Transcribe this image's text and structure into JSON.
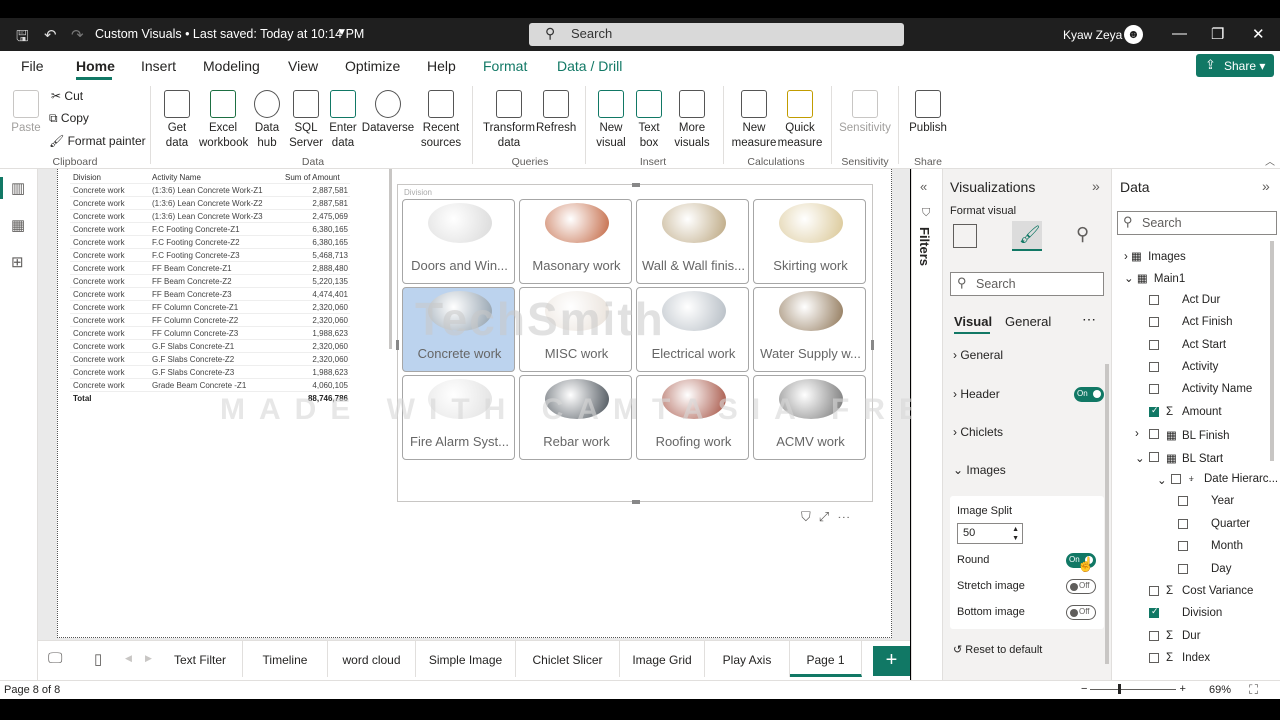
{
  "titlebar": {
    "doc_title": "Custom Visuals • Last saved: Today at 10:14 PM",
    "search_placeholder": "Search",
    "user_name": "Kyaw Zeya"
  },
  "menu": {
    "items": [
      "File",
      "Home",
      "Insert",
      "Modeling",
      "View",
      "Optimize",
      "Help",
      "Format",
      "Data / Drill"
    ],
    "share": "Share"
  },
  "ribbon": {
    "clipboard": {
      "paste": "Paste",
      "cut": "Cut",
      "copy": "Copy",
      "format_painter": "Format painter",
      "group": "Clipboard"
    },
    "data": {
      "get_data": "Get data",
      "excel": "Excel workbook",
      "hub": "Data hub",
      "sql": "SQL Server",
      "enter": "Enter data",
      "dataverse": "Dataverse",
      "recent": "Recent sources",
      "group": "Data"
    },
    "queries": {
      "transform": "Transform data",
      "refresh": "Refresh",
      "group": "Queries"
    },
    "insert": {
      "new_visual": "New visual",
      "text_box": "Text box",
      "more_visuals": "More visuals",
      "group": "Insert"
    },
    "calculations": {
      "new_measure": "New measure",
      "quick_measure": "Quick measure",
      "group": "Calculations"
    },
    "sensitivity": {
      "label": "Sensitivity",
      "group": "Sensitivity"
    },
    "share": {
      "publish": "Publish",
      "group": "Share"
    }
  },
  "table": {
    "headers": [
      "Division",
      "Activity Name",
      "Sum of Amount"
    ],
    "rows": [
      [
        "Concrete work",
        "(1:3:6) Lean Concrete Work-Z1",
        "2,887,581"
      ],
      [
        "Concrete work",
        "(1:3:6) Lean Concrete Work-Z2",
        "2,887,581"
      ],
      [
        "Concrete work",
        "(1:3:6) Lean Concrete Work-Z3",
        "2,475,069"
      ],
      [
        "Concrete work",
        "F.C Footing Concrete-Z1",
        "6,380,165"
      ],
      [
        "Concrete work",
        "F.C Footing Concrete-Z2",
        "6,380,165"
      ],
      [
        "Concrete work",
        "F.C Footing Concrete-Z3",
        "5,468,713"
      ],
      [
        "Concrete work",
        "FF Beam Concrete-Z1",
        "2,888,480"
      ],
      [
        "Concrete work",
        "FF Beam Concrete-Z2",
        "5,220,135"
      ],
      [
        "Concrete work",
        "FF Beam Concrete-Z3",
        "4,474,401"
      ],
      [
        "Concrete work",
        "FF Column Concrete-Z1",
        "2,320,060"
      ],
      [
        "Concrete work",
        "FF Column Concrete-Z2",
        "2,320,060"
      ],
      [
        "Concrete work",
        "FF Column Concrete-Z3",
        "1,988,623"
      ],
      [
        "Concrete work",
        "G.F Slabs Concrete-Z1",
        "2,320,060"
      ],
      [
        "Concrete work",
        "G.F Slabs Concrete-Z2",
        "2,320,060"
      ],
      [
        "Concrete work",
        "G.F Slabs Concrete-Z3",
        "1,988,623"
      ],
      [
        "Concrete work",
        "Grade Beam Concrete -Z1",
        "4,060,105"
      ]
    ],
    "total_label": "Total",
    "total_value": "88,746,786"
  },
  "grid": {
    "title": "Division",
    "tiles": [
      {
        "label": "Doors and Win...",
        "color": "#d8d8d8"
      },
      {
        "label": "Masonary work",
        "color": "#c0603a"
      },
      {
        "label": "Wall & Wall finis...",
        "color": "#b8a27a"
      },
      {
        "label": "Skirting work",
        "color": "#d8c490"
      },
      {
        "label": "Concrete work",
        "color": "#8a9aa8"
      },
      {
        "label": "MISC work",
        "color": "#e8e0d8"
      },
      {
        "label": "Electrical work",
        "color": "#b0b8c0"
      },
      {
        "label": "Water Supply w...",
        "color": "#8a7050"
      },
      {
        "label": "Fire Alarm Syst...",
        "color": "#e0e0e0"
      },
      {
        "label": "Rebar work",
        "color": "#404850"
      },
      {
        "label": "Roofing work",
        "color": "#a04838"
      },
      {
        "label": "ACMV work",
        "color": "#707070"
      }
    ]
  },
  "watermark": {
    "brand": "TechSmith",
    "trial": "MADE WITH CAMTASIA FREE TRIAL"
  },
  "filters": {
    "label": "Filters"
  },
  "visualizations": {
    "title": "Visualizations",
    "subtitle": "Format visual",
    "search": "Search",
    "tabs": [
      "Visual",
      "General"
    ],
    "sections": {
      "general": "General",
      "header": "Header",
      "chiclets": "Chiclets",
      "images": "Images"
    },
    "header_toggle": "On",
    "image_split_label": "Image Split",
    "image_split_value": "50",
    "round_label": "Round",
    "round_toggle": "On",
    "stretch_label": "Stretch image",
    "stretch_toggle": "Off",
    "bottom_label": "Bottom image",
    "bottom_toggle": "Off",
    "reset": "Reset to default"
  },
  "data_pane": {
    "title": "Data",
    "search": "Search",
    "fields": [
      {
        "label": "Images",
        "level": 0,
        "type": "table",
        "check": null
      },
      {
        "label": "Main1",
        "level": 0,
        "type": "table",
        "check": null
      },
      {
        "label": "Act Dur",
        "level": 1,
        "type": "field",
        "check": false
      },
      {
        "label": "Act Finish",
        "level": 1,
        "type": "field",
        "check": false
      },
      {
        "label": "Act Start",
        "level": 1,
        "type": "field",
        "check": false
      },
      {
        "label": "Activity",
        "level": 1,
        "type": "field",
        "check": false
      },
      {
        "label": "Activity Name",
        "level": 1,
        "type": "field",
        "check": false
      },
      {
        "label": "Amount",
        "level": 1,
        "type": "sigma",
        "check": true
      },
      {
        "label": "BL Finish",
        "level": 1,
        "type": "date",
        "check": false
      },
      {
        "label": "BL Start",
        "level": 1,
        "type": "date",
        "check": false
      },
      {
        "label": "Date Hierarc...",
        "level": 2,
        "type": "hier",
        "check": false
      },
      {
        "label": "Year",
        "level": 3,
        "type": "field",
        "check": false
      },
      {
        "label": "Quarter",
        "level": 3,
        "type": "field",
        "check": false
      },
      {
        "label": "Month",
        "level": 3,
        "type": "field",
        "check": false
      },
      {
        "label": "Day",
        "level": 3,
        "type": "field",
        "check": false
      },
      {
        "label": "Cost Variance",
        "level": 1,
        "type": "sigma",
        "check": false
      },
      {
        "label": "Division",
        "level": 1,
        "type": "field",
        "check": true
      },
      {
        "label": "Dur",
        "level": 1,
        "type": "sigma",
        "check": false
      },
      {
        "label": "Index",
        "level": 1,
        "type": "sigma",
        "check": false
      }
    ]
  },
  "pages": {
    "tabs": [
      "Text Filter",
      "Timeline",
      "word cloud",
      "Simple Image",
      "Chiclet Slicer",
      "Image Grid",
      "Play Axis",
      "Page 1"
    ],
    "active": "Page 1"
  },
  "status": {
    "page_count": "Page 8 of 8",
    "zoom": "69%"
  }
}
